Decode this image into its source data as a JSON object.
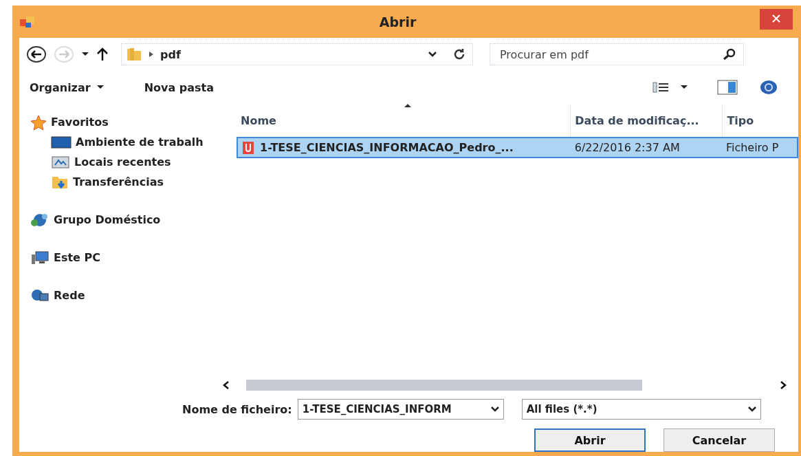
{
  "window": {
    "title": "Abrir"
  },
  "nav": {
    "path": [
      "pdf"
    ],
    "search": {
      "placeholder": "Procurar em pdf"
    }
  },
  "toolbar": {
    "organize": "Organizar",
    "new_folder": "Nova pasta"
  },
  "sidebar": [
    {
      "label": "Favoritos",
      "kind": "star",
      "children": [
        {
          "label": "Ambiente de trabalh",
          "kind": "desktop"
        },
        {
          "label": "Locais recentes",
          "kind": "recent"
        },
        {
          "label": "Transferências",
          "kind": "downloads"
        }
      ]
    },
    {
      "label": "Grupo Doméstico",
      "kind": "homegroup"
    },
    {
      "label": "Este PC",
      "kind": "pc"
    },
    {
      "label": "Rede",
      "kind": "network"
    }
  ],
  "table": {
    "columns": [
      {
        "label": "Nome",
        "sorted": true
      },
      {
        "label": "Data de modificaç...",
        "sorted": false
      },
      {
        "label": "Tipo",
        "sorted": false
      }
    ],
    "rows": [
      {
        "cells": [
          "1-TESE_CIENCIAS_INFORMACAO_Pedro_...",
          "6/22/2016 2:37 AM",
          "Ficheiro P"
        ],
        "selected": true
      }
    ]
  },
  "footer": {
    "filename_label": "Nome de ficheiro:",
    "filename": "1-TESE_CIENCIAS_INFORM",
    "filter": "All files (*.*)",
    "buttons": [
      {
        "label": "Abrir",
        "default": true
      },
      {
        "label": "Cancelar",
        "default": false
      }
    ]
  }
}
